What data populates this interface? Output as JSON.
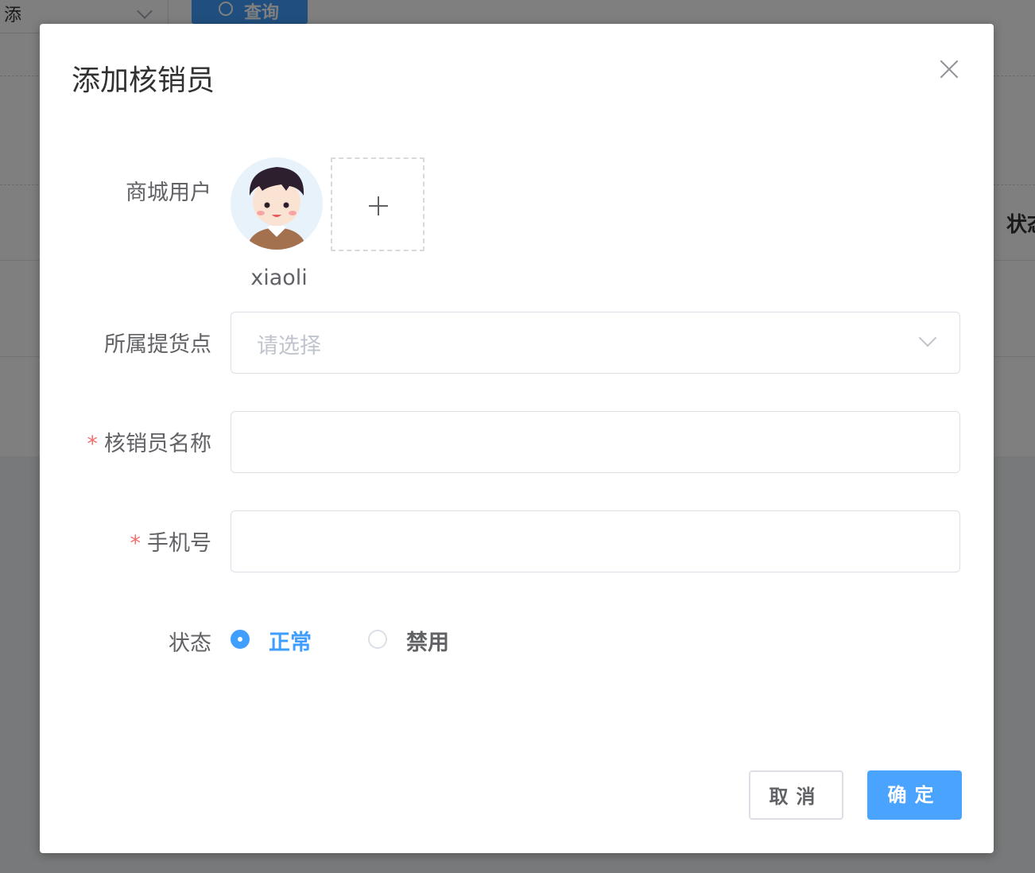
{
  "background": {
    "select_text": "添",
    "query_button_label": "查询",
    "column_header": "状态"
  },
  "dialog": {
    "title": "添加核销员"
  },
  "form": {
    "user_label": "商城用户",
    "username": "xiaoli",
    "pickup_label": "所属提货点",
    "pickup_placeholder": "请选择",
    "name_label": "核销员名称",
    "name_value": "",
    "phone_label": "手机号",
    "phone_value": "",
    "status_label": "状态",
    "status_options": [
      {
        "label": "正常",
        "checked": true
      },
      {
        "label": "禁用",
        "checked": false
      }
    ],
    "required_mark": "*"
  },
  "footer": {
    "cancel_label": "取消",
    "confirm_label": "确定"
  },
  "colors": {
    "primary": "#409eff",
    "danger": "#f56c6c"
  }
}
